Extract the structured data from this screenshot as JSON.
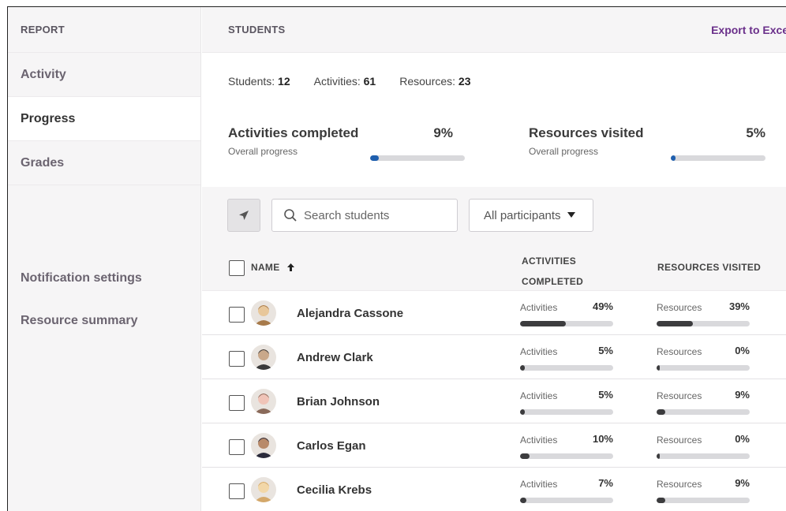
{
  "sidebar": {
    "header": "REPORT",
    "items": [
      {
        "label": "Activity",
        "active": false
      },
      {
        "label": "Progress",
        "active": true
      },
      {
        "label": "Grades",
        "active": false
      }
    ],
    "secondary": [
      {
        "label": "Notification settings"
      },
      {
        "label": "Resource summary"
      }
    ]
  },
  "header": {
    "title": "STUDENTS",
    "export_label": "Export to Excel"
  },
  "summary": {
    "students_label": "Students:",
    "students_value": "12",
    "activities_label": "Activities:",
    "activities_value": "61",
    "resources_label": "Resources:",
    "resources_value": "23",
    "activities_completed": {
      "title": "Activities completed",
      "pct": "9%",
      "value": 0.09,
      "sub": "Overall progress"
    },
    "resources_visited": {
      "title": "Resources visited",
      "pct": "5%",
      "value": 0.05,
      "sub": "Overall progress"
    }
  },
  "toolbar": {
    "search_placeholder": "Search students",
    "filter_value": "All participants"
  },
  "table": {
    "col_name": "NAME",
    "col_activities_line1": "ACTIVITIES",
    "col_activities_line2": "COMPLETED",
    "col_resources": "RESOURCES VISITED",
    "activities_label": "Activities",
    "resources_label": "Resources",
    "rows": [
      {
        "name": "Alejandra Cassone",
        "act_pct": "49%",
        "act": 0.49,
        "res_pct": "39%",
        "res": 0.39
      },
      {
        "name": "Andrew Clark",
        "act_pct": "5%",
        "act": 0.05,
        "res_pct": "0%",
        "res": 0.0
      },
      {
        "name": "Brian Johnson",
        "act_pct": "5%",
        "act": 0.05,
        "res_pct": "9%",
        "res": 0.09
      },
      {
        "name": "Carlos Egan",
        "act_pct": "10%",
        "act": 0.1,
        "res_pct": "0%",
        "res": 0.0
      },
      {
        "name": "Cecilia Krebs",
        "act_pct": "7%",
        "act": 0.07,
        "res_pct": "9%",
        "res": 0.09
      }
    ]
  },
  "colors": {
    "accent": "#6a2f8a",
    "overall_bar_fill": "#1f5fae",
    "row_bar_fill": "#3c3c3e",
    "bar_track": "#d9d9dc"
  }
}
